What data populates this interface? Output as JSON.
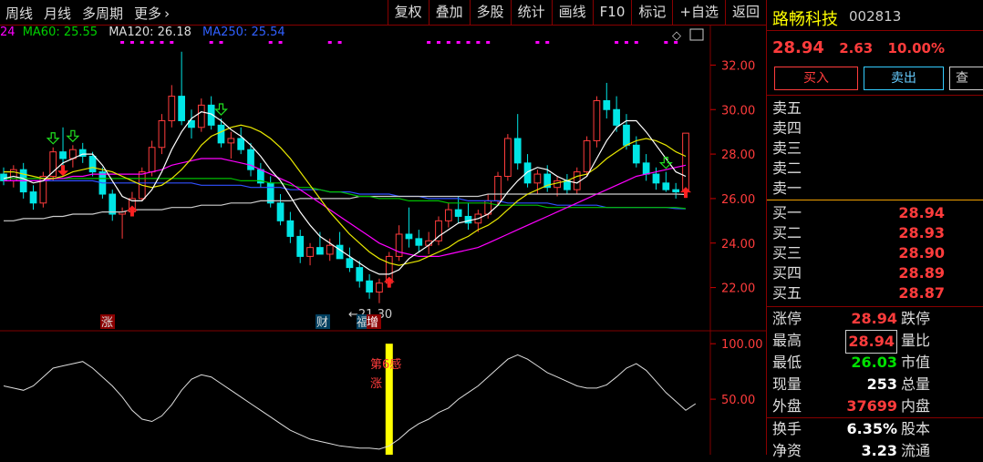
{
  "toolbar": {
    "left": [
      "周线",
      "月线",
      "多周期",
      "更多"
    ],
    "more_arrow": "›",
    "right": [
      "复权",
      "叠加",
      "多股",
      "统计",
      "画线",
      "F10",
      "标记",
      "+自选",
      "返回"
    ]
  },
  "ma": {
    "ma_cut": "24",
    "ma60_label": "MA60: 25.55",
    "ma120_label": "MA120: 26.18",
    "ma250_label": "MA250: 25.54"
  },
  "colors": {
    "up": "#ff3c3c",
    "down": "#00e5e5",
    "ma5": "#ffffff",
    "ma10": "#e8e800",
    "ma20": "#ff00ff",
    "ma60": "#00c000",
    "ma120": "#cccccc",
    "ma250": "#3050ff",
    "grid": "#800000"
  },
  "stock": {
    "name": "路畅科技",
    "code": "002813",
    "price": "28.94",
    "change": "2.63",
    "change_pct": "10.00%"
  },
  "buttons": {
    "buy": "买入",
    "sell": "卖出",
    "more": "查"
  },
  "sell_orders": [
    "卖五",
    "卖四",
    "卖三",
    "卖二",
    "卖一"
  ],
  "buy_orders": [
    {
      "label": "买一",
      "price": "28.94"
    },
    {
      "label": "买二",
      "price": "28.93"
    },
    {
      "label": "买三",
      "price": "28.90"
    },
    {
      "label": "买四",
      "price": "28.89"
    },
    {
      "label": "买五",
      "price": "28.87"
    }
  ],
  "stats": [
    {
      "label": "涨停",
      "value": "28.94",
      "label2": "跌停",
      "color": "#ff3c3c"
    },
    {
      "label": "最高",
      "value": "28.94",
      "label2": "量比",
      "color": "#ff3c3c",
      "boxed": true
    },
    {
      "label": "最低",
      "value": "26.03",
      "label2": "市值",
      "color": "#00e000"
    },
    {
      "label": "现量",
      "value": "253",
      "label2": "总量",
      "color": "#ffffff"
    },
    {
      "label": "外盘",
      "value": "37699",
      "label2": "内盘",
      "color": "#ff3c3c"
    },
    {
      "label": "换手",
      "value": "6.35%",
      "label2": "股本",
      "color": "#ffffff"
    },
    {
      "label": "净资",
      "value": "3.23",
      "label2": "流通",
      "color": "#ffffff"
    }
  ],
  "annotations": {
    "low_price": "←21.30",
    "zhang_marker": "涨",
    "cai_marker": "财",
    "fu_marker": "福",
    "zeng_marker": "增",
    "signal_title": "第6感",
    "signal_zhang": "涨"
  },
  "chart_data": {
    "type": "candlestick",
    "ylim": [
      21.0,
      33.0
    ],
    "y_ticks": [
      22.0,
      24.0,
      26.0,
      28.0,
      30.0,
      32.0
    ],
    "y_tick_labels": [
      "22.00",
      "24.00",
      "26.00",
      "28.00",
      "30.00",
      "32.00"
    ],
    "candles": [
      [
        27.1,
        27.4,
        26.6,
        26.8
      ],
      [
        26.8,
        27.5,
        26.5,
        27.3
      ],
      [
        27.3,
        27.6,
        26.0,
        26.3
      ],
      [
        26.3,
        26.6,
        25.5,
        25.8
      ],
      [
        25.8,
        27.2,
        25.6,
        27.0
      ],
      [
        27.0,
        28.3,
        26.8,
        28.1
      ],
      [
        28.1,
        29.2,
        27.5,
        27.8
      ],
      [
        27.8,
        28.4,
        27.4,
        28.2
      ],
      [
        28.2,
        28.5,
        27.6,
        27.9
      ],
      [
        27.9,
        28.1,
        27.0,
        27.2
      ],
      [
        27.2,
        27.4,
        26.0,
        26.2
      ],
      [
        26.2,
        26.4,
        25.0,
        25.3
      ],
      [
        25.3,
        25.6,
        24.2,
        25.4
      ],
      [
        25.4,
        26.3,
        25.2,
        26.0
      ],
      [
        26.0,
        27.4,
        25.9,
        27.2
      ],
      [
        27.2,
        28.6,
        27.0,
        28.3
      ],
      [
        28.3,
        29.8,
        28.0,
        29.5
      ],
      [
        29.5,
        31.1,
        29.2,
        30.6
      ],
      [
        30.6,
        32.6,
        29.3,
        29.5
      ],
      [
        29.5,
        30.0,
        28.7,
        29.2
      ],
      [
        29.2,
        30.5,
        29.0,
        30.2
      ],
      [
        30.2,
        30.6,
        29.1,
        29.3
      ],
      [
        29.3,
        29.6,
        28.3,
        28.5
      ],
      [
        28.5,
        29.0,
        27.8,
        28.7
      ],
      [
        28.7,
        29.2,
        28.0,
        28.2
      ],
      [
        28.2,
        28.5,
        27.0,
        27.3
      ],
      [
        27.3,
        27.6,
        26.5,
        26.7
      ],
      [
        26.7,
        27.0,
        25.6,
        25.8
      ],
      [
        25.8,
        26.2,
        24.8,
        25.0
      ],
      [
        25.0,
        25.4,
        24.0,
        24.3
      ],
      [
        24.3,
        24.6,
        23.1,
        23.4
      ],
      [
        23.4,
        24.0,
        23.0,
        23.8
      ],
      [
        23.8,
        24.5,
        23.6,
        23.5
      ],
      [
        23.5,
        24.2,
        23.2,
        23.9
      ],
      [
        23.9,
        24.5,
        23.4,
        23.3
      ],
      [
        23.3,
        23.8,
        22.7,
        22.9
      ],
      [
        22.9,
        23.2,
        22.0,
        22.3
      ],
      [
        22.3,
        22.6,
        21.5,
        21.8
      ],
      [
        21.8,
        22.4,
        21.3,
        22.2
      ],
      [
        22.2,
        23.6,
        22.0,
        23.4
      ],
      [
        23.4,
        24.8,
        23.2,
        24.4
      ],
      [
        24.4,
        25.6,
        23.8,
        24.2
      ],
      [
        24.2,
        24.6,
        23.6,
        23.9
      ],
      [
        23.9,
        24.5,
        23.5,
        24.1
      ],
      [
        24.1,
        25.2,
        23.9,
        25.0
      ],
      [
        25.0,
        25.8,
        24.7,
        25.5
      ],
      [
        25.5,
        26.1,
        24.9,
        25.2
      ],
      [
        25.2,
        25.8,
        24.6,
        24.9
      ],
      [
        24.9,
        25.5,
        24.5,
        25.3
      ],
      [
        25.3,
        26.2,
        25.1,
        25.9
      ],
      [
        25.9,
        27.2,
        25.7,
        27.0
      ],
      [
        27.0,
        28.9,
        26.8,
        28.7
      ],
      [
        28.7,
        29.8,
        27.3,
        27.6
      ],
      [
        27.6,
        28.0,
        26.5,
        26.7
      ],
      [
        26.7,
        27.3,
        26.2,
        27.1
      ],
      [
        27.1,
        27.5,
        26.3,
        26.5
      ],
      [
        26.5,
        27.0,
        26.1,
        26.8
      ],
      [
        26.8,
        27.1,
        26.2,
        26.4
      ],
      [
        26.4,
        27.4,
        26.2,
        27.2
      ],
      [
        27.2,
        28.8,
        27.0,
        28.6
      ],
      [
        28.6,
        30.6,
        28.3,
        30.4
      ],
      [
        30.4,
        31.2,
        29.6,
        30.0
      ],
      [
        30.0,
        30.6,
        29.0,
        29.3
      ],
      [
        29.3,
        29.8,
        28.2,
        28.4
      ],
      [
        28.4,
        28.8,
        27.4,
        27.6
      ],
      [
        27.6,
        28.0,
        26.8,
        27.1
      ],
      [
        27.1,
        27.4,
        26.4,
        26.7
      ],
      [
        26.7,
        27.2,
        26.3,
        26.4
      ],
      [
        26.4,
        26.7,
        26.0,
        26.3
      ],
      [
        26.31,
        28.94,
        26.03,
        28.94
      ]
    ],
    "ma5": [
      26.9,
      27.0,
      26.9,
      26.7,
      26.8,
      27.2,
      27.6,
      27.8,
      28.0,
      28.0,
      27.5,
      26.8,
      26.1,
      25.9,
      25.9,
      26.4,
      27.2,
      28.2,
      29.0,
      29.6,
      29.9,
      29.8,
      29.5,
      29.1,
      28.8,
      28.4,
      27.9,
      27.3,
      26.8,
      26.1,
      25.4,
      24.8,
      24.3,
      24.0,
      23.7,
      23.4,
      23.1,
      22.8,
      22.6,
      22.6,
      22.8,
      23.3,
      23.6,
      23.9,
      24.3,
      24.6,
      24.9,
      25.0,
      25.1,
      25.3,
      25.7,
      26.3,
      26.8,
      27.2,
      27.4,
      27.3,
      27.0,
      26.8,
      26.7,
      27.0,
      27.8,
      28.6,
      29.2,
      29.5,
      29.5,
      29.0,
      28.4,
      27.8,
      27.2,
      27.0
    ],
    "ma10": [
      27.2,
      27.2,
      27.1,
      27.0,
      26.9,
      26.9,
      27.0,
      27.2,
      27.3,
      27.4,
      27.3,
      27.2,
      27.0,
      26.8,
      26.6,
      26.5,
      26.6,
      26.9,
      27.3,
      27.8,
      28.4,
      28.8,
      29.0,
      29.2,
      29.3,
      29.2,
      29.0,
      28.7,
      28.3,
      27.8,
      27.2,
      26.6,
      26.0,
      25.4,
      24.9,
      24.4,
      24.0,
      23.6,
      23.3,
      23.1,
      23.0,
      23.1,
      23.2,
      23.4,
      23.6,
      23.8,
      24.1,
      24.3,
      24.6,
      24.8,
      25.1,
      25.5,
      25.9,
      26.2,
      26.4,
      26.6,
      26.7,
      26.8,
      27.0,
      27.1,
      27.4,
      27.8,
      28.1,
      28.4,
      28.6,
      28.7,
      28.6,
      28.4,
      28.1,
      27.9
    ],
    "ma20": [
      26.8,
      26.8,
      26.8,
      26.8,
      26.8,
      26.9,
      26.9,
      27.0,
      27.0,
      27.1,
      27.1,
      27.1,
      27.1,
      27.1,
      27.1,
      27.2,
      27.3,
      27.5,
      27.6,
      27.7,
      27.8,
      27.8,
      27.8,
      27.7,
      27.6,
      27.5,
      27.3,
      27.1,
      26.9,
      26.7,
      26.4,
      26.1,
      25.8,
      25.5,
      25.2,
      24.9,
      24.6,
      24.3,
      24.0,
      23.8,
      23.6,
      23.5,
      23.4,
      23.4,
      23.4,
      23.5,
      23.6,
      23.7,
      23.8,
      24.0,
      24.2,
      24.4,
      24.6,
      24.8,
      25.0,
      25.2,
      25.4,
      25.6,
      25.8,
      26.0,
      26.2,
      26.4,
      26.6,
      26.8,
      27.0,
      27.1,
      27.2,
      27.3,
      27.4,
      27.5
    ],
    "ma60": [
      26.9,
      26.9,
      26.9,
      26.9,
      26.9,
      26.9,
      26.9,
      26.9,
      26.9,
      26.9,
      26.9,
      26.9,
      26.9,
      26.9,
      26.9,
      26.9,
      26.9,
      26.9,
      26.9,
      26.9,
      26.9,
      26.9,
      26.9,
      26.9,
      26.8,
      26.8,
      26.8,
      26.7,
      26.7,
      26.6,
      26.5,
      26.5,
      26.4,
      26.3,
      26.3,
      26.2,
      26.1,
      26.1,
      26.0,
      26.0,
      26.0,
      25.9,
      25.9,
      25.9,
      25.9,
      25.8,
      25.8,
      25.8,
      25.8,
      25.8,
      25.7,
      25.7,
      25.7,
      25.7,
      25.7,
      25.6,
      25.6,
      25.6,
      25.6,
      25.6,
      25.6,
      25.6,
      25.6,
      25.6,
      25.6,
      25.6,
      25.6,
      25.6,
      25.6,
      25.55
    ],
    "ma120": [
      25.0,
      25.0,
      25.1,
      25.1,
      25.1,
      25.2,
      25.2,
      25.3,
      25.3,
      25.3,
      25.4,
      25.4,
      25.4,
      25.5,
      25.5,
      25.5,
      25.5,
      25.6,
      25.6,
      25.6,
      25.7,
      25.7,
      25.7,
      25.8,
      25.8,
      25.8,
      25.9,
      25.9,
      25.9,
      25.9,
      26.0,
      26.0,
      26.0,
      26.0,
      26.0,
      26.0,
      26.1,
      26.1,
      26.1,
      26.1,
      26.1,
      26.1,
      26.1,
      26.1,
      26.1,
      26.1,
      26.1,
      26.1,
      26.1,
      26.2,
      26.2,
      26.2,
      26.2,
      26.2,
      26.2,
      26.2,
      26.2,
      26.2,
      26.2,
      26.2,
      26.2,
      26.2,
      26.2,
      26.2,
      26.2,
      26.2,
      26.2,
      26.2,
      26.2,
      26.18
    ],
    "ma250": [
      26.8,
      26.8,
      26.8,
      26.8,
      26.8,
      26.8,
      26.8,
      26.8,
      26.8,
      26.8,
      26.7,
      26.7,
      26.7,
      26.7,
      26.7,
      26.7,
      26.7,
      26.7,
      26.7,
      26.7,
      26.6,
      26.6,
      26.6,
      26.6,
      26.6,
      26.5,
      26.5,
      26.5,
      26.5,
      26.4,
      26.4,
      26.4,
      26.4,
      26.3,
      26.3,
      26.3,
      26.2,
      26.2,
      26.2,
      26.2,
      26.1,
      26.1,
      26.1,
      26.0,
      26.0,
      26.0,
      26.0,
      25.9,
      25.9,
      25.9,
      25.9,
      25.8,
      25.8,
      25.8,
      25.8,
      25.8,
      25.7,
      25.7,
      25.7,
      25.7,
      25.7,
      25.6,
      25.6,
      25.6,
      25.6,
      25.6,
      25.6,
      25.6,
      25.55,
      25.54
    ],
    "indicator": {
      "ylim": [
        0,
        110
      ],
      "y_ticks": [
        50,
        100
      ],
      "y_tick_labels": [
        "50.00",
        "100.00"
      ],
      "line": [
        62,
        60,
        58,
        62,
        70,
        78,
        80,
        82,
        84,
        78,
        70,
        62,
        52,
        40,
        32,
        30,
        35,
        45,
        58,
        68,
        72,
        70,
        64,
        58,
        52,
        46,
        40,
        34,
        28,
        22,
        18,
        14,
        12,
        10,
        8,
        7,
        6,
        6,
        5,
        8,
        14,
        22,
        28,
        32,
        38,
        42,
        50,
        56,
        62,
        70,
        78,
        86,
        90,
        86,
        80,
        74,
        70,
        66,
        62,
        60,
        60,
        63,
        70,
        78,
        82,
        76,
        66,
        56,
        48,
        40,
        46
      ],
      "signal_index": 39,
      "signal_value": 100
    },
    "markers": {
      "red_up": [
        13,
        39,
        69
      ],
      "green_down": [
        5,
        7,
        22,
        67
      ],
      "red_down": [
        6
      ],
      "purple_dot_positions": [
        12,
        13,
        14,
        15,
        16,
        17,
        21,
        22,
        27,
        28,
        33,
        34,
        43,
        44,
        45,
        46,
        47,
        48,
        49,
        54,
        55,
        62,
        63,
        64,
        67,
        68
      ]
    }
  }
}
